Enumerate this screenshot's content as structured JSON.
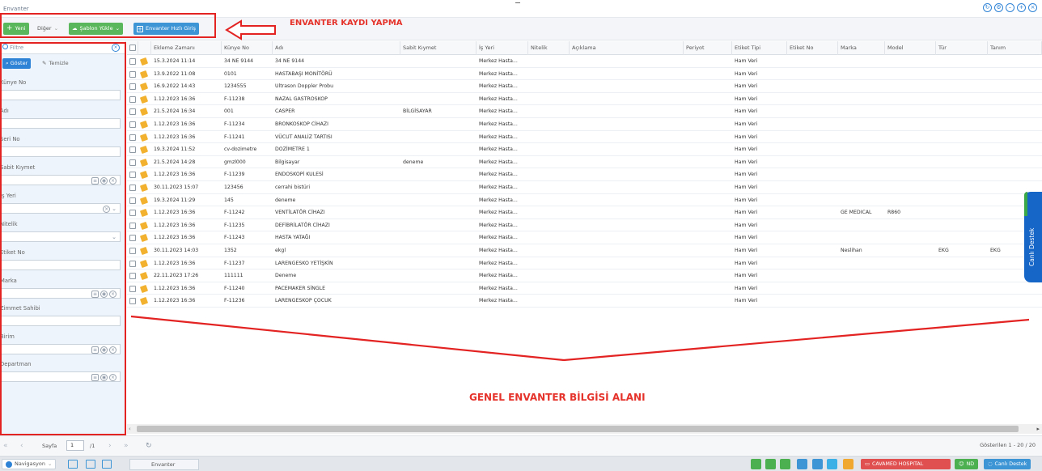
{
  "app": {
    "title": "Envanter"
  },
  "toolbar": {
    "new_label": "Yeni",
    "other_label": "Diğer",
    "template_label": "Şablon Yükle",
    "quick_entry_label": "Envanter Hızlı Giriş"
  },
  "annotations": {
    "top": "ENVANTER KAYDI YAPMA",
    "main": "GENEL ENVANTER BİLGİSİ ALANI"
  },
  "filter": {
    "title": "Filtre",
    "show_label": "Göster",
    "clean_label": "Temizle",
    "fields": [
      {
        "label": "Künye No"
      },
      {
        "label": "Adı"
      },
      {
        "label": "Seri No"
      },
      {
        "label": "Sabit Kıymet"
      },
      {
        "label": "İş Yeri"
      },
      {
        "label": "Nitelik"
      },
      {
        "label": "Etiket No"
      },
      {
        "label": "Marka"
      },
      {
        "label": "Zimmet Sahibi"
      },
      {
        "label": "Birim"
      },
      {
        "label": "Departman"
      }
    ]
  },
  "grid": {
    "columns": [
      "",
      "",
      "Ekleme Zamanı",
      "Künye No",
      "Adı",
      "Sabit Kıymet",
      "İş Yeri",
      "Nitelik",
      "Açıklama",
      "Periyot",
      "Etiket Tipi",
      "Etiket No",
      "Marka",
      "Model",
      "Tür",
      "Tanım"
    ],
    "rows": [
      [
        "15.3.2024 11:14",
        "34 NE 9144",
        "34 NE 9144",
        "",
        "Merkez Hasta...",
        "",
        "",
        "",
        "Ham Veri",
        "",
        "",
        "",
        "",
        ""
      ],
      [
        "13.9.2022 11:08",
        "0101",
        "HASTABAŞI MONİTÖRÜ",
        "",
        "Merkez Hasta...",
        "",
        "",
        "",
        "Ham Veri",
        "",
        "",
        "",
        "",
        ""
      ],
      [
        "16.9.2022 14:43",
        "1234555",
        "Ultrason Doppler Probu",
        "",
        "Merkez Hasta...",
        "",
        "",
        "",
        "Ham Veri",
        "",
        "",
        "",
        "",
        ""
      ],
      [
        "1.12.2023 16:36",
        "F-11238",
        "NAZAL GASTROSKOP",
        "",
        "Merkez Hasta...",
        "",
        "",
        "",
        "Ham Veri",
        "",
        "",
        "",
        "",
        ""
      ],
      [
        "21.5.2024 16:34",
        "001",
        "CASPER",
        "BİLGİSAYAR",
        "Merkez Hasta...",
        "",
        "",
        "",
        "Ham Veri",
        "",
        "",
        "",
        "",
        ""
      ],
      [
        "1.12.2023 16:36",
        "F-11234",
        "BRONKOSKOP CİHAZI",
        "",
        "Merkez Hasta...",
        "",
        "",
        "",
        "Ham Veri",
        "",
        "",
        "",
        "",
        ""
      ],
      [
        "1.12.2023 16:36",
        "F-11241",
        "VÜCUT ANALİZ TARTISI",
        "",
        "Merkez Hasta...",
        "",
        "",
        "",
        "Ham Veri",
        "",
        "",
        "",
        "",
        ""
      ],
      [
        "19.3.2024 11:52",
        "cv-dozimetre",
        "DOZİMETRE 1",
        "",
        "Merkez Hasta...",
        "",
        "",
        "",
        "Ham Veri",
        "",
        "",
        "",
        "",
        ""
      ],
      [
        "21.5.2024 14:28",
        "gmzl000",
        "Bilgisayar",
        "deneme",
        "Merkez Hasta...",
        "",
        "",
        "",
        "Ham Veri",
        "",
        "",
        "",
        "",
        ""
      ],
      [
        "1.12.2023 16:36",
        "F-11239",
        "ENDOSKOPİ KULESİ",
        "",
        "Merkez Hasta...",
        "",
        "",
        "",
        "Ham Veri",
        "",
        "",
        "",
        "",
        ""
      ],
      [
        "30.11.2023 15:07",
        "123456",
        "cerrahi bistüri",
        "",
        "Merkez Hasta...",
        "",
        "",
        "",
        "Ham Veri",
        "",
        "",
        "",
        "",
        ""
      ],
      [
        "19.3.2024 11:29",
        "145",
        "deneme",
        "",
        "Merkez Hasta...",
        "",
        "",
        "",
        "Ham Veri",
        "",
        "",
        "",
        "",
        ""
      ],
      [
        "1.12.2023 16:36",
        "F-11242",
        "VENTİLATÖR CİHAZI",
        "",
        "Merkez Hasta...",
        "",
        "",
        "",
        "Ham Veri",
        "",
        "GE MEDICAL",
        "R860",
        "",
        ""
      ],
      [
        "1.12.2023 16:36",
        "F-11235",
        "DEFİBRİLATÖR CİHAZI",
        "",
        "Merkez Hasta...",
        "",
        "",
        "",
        "Ham Veri",
        "",
        "",
        "",
        "",
        ""
      ],
      [
        "1.12.2023 16:36",
        "F-11243",
        "HASTA YATAĞI",
        "",
        "Merkez Hasta...",
        "",
        "",
        "",
        "Ham Veri",
        "",
        "",
        "",
        "",
        ""
      ],
      [
        "30.11.2023 14:03",
        "1352",
        "ekgl",
        "",
        "Merkez Hasta...",
        "",
        "",
        "",
        "Ham Veri",
        "",
        "Neslihan",
        "",
        "EKG",
        "EKG"
      ],
      [
        "1.12.2023 16:36",
        "F-11237",
        "LARENGESKO YETİŞKİN",
        "",
        "Merkez Hasta...",
        "",
        "",
        "",
        "Ham Veri",
        "",
        "",
        "",
        "",
        ""
      ],
      [
        "22.11.2023 17:26",
        "111111",
        "Deneme",
        "",
        "Merkez Hasta...",
        "",
        "",
        "",
        "Ham Veri",
        "",
        "",
        "",
        "",
        ""
      ],
      [
        "1.12.2023 16:36",
        "F-11240",
        "PACEMAKER SİNGLE",
        "",
        "Merkez Hasta...",
        "",
        "",
        "",
        "Ham Veri",
        "",
        "",
        "",
        "",
        ""
      ],
      [
        "1.12.2023 16:36",
        "F-11236",
        "LARENGESKOP ÇOCUK",
        "",
        "Merkez Hasta...",
        "",
        "",
        "",
        "Ham Veri",
        "",
        "",
        "",
        "",
        ""
      ]
    ]
  },
  "pager": {
    "page_label": "Sayfa",
    "page_value": "1",
    "total_pages": "/1",
    "count_text": "Gösterilen 1 - 20 / 20"
  },
  "statusbar": {
    "nav_label": "Navigasyon",
    "tab_label": "Envanter",
    "hospital_label": "CAVAMED HOSPITAL",
    "user_label": "ND",
    "support_label": "Canlı Destek"
  },
  "live_support": {
    "label": "Canlı Destek"
  },
  "colors": {
    "annotation_red": "#e32222",
    "primary_blue": "#2f83d6",
    "green": "#5bb75b",
    "hospital_red": "#e05050",
    "live_blue": "#1666c8"
  }
}
